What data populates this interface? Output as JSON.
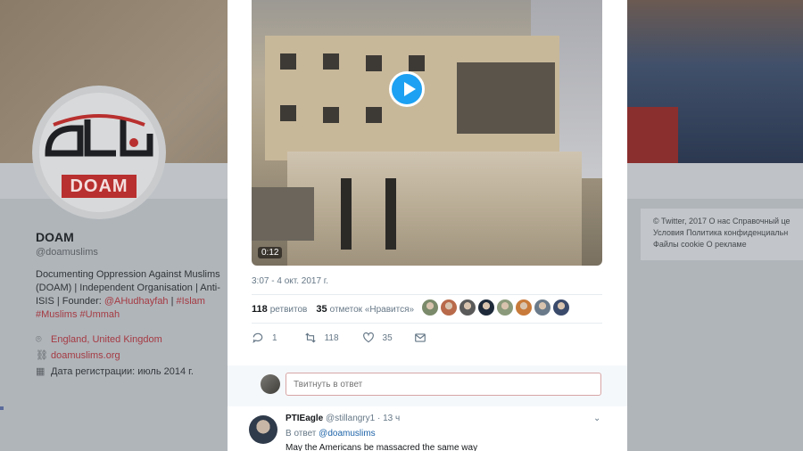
{
  "profile": {
    "logo_text": "DOAM",
    "name": "DOAM",
    "handle": "@doamuslims",
    "bio_text": "Documenting Oppression Against Muslims (DOAM) | Independent Organisation | Anti-ISIS | Founder: ",
    "bio_founder": "@AHudhayfah",
    "bio_sep": " | ",
    "bio_tag1": "#Islam",
    "bio_tag2": "#Muslims",
    "bio_tag3": "#Ummah",
    "location": "England, United Kingdom",
    "website": "doamuslims.org",
    "joined": "Дата регистрации: июль 2014 г."
  },
  "footer": {
    "line1": "© Twitter, 2017   О нас   Справочный це",
    "line2": "Условия   Политика конфиденциальн",
    "line3": "Файлы cookie   О рекламе"
  },
  "tweet": {
    "video_time": "0:12",
    "timestamp": "3:07 - 4 окт. 2017 г.",
    "retweets_count": "118",
    "retweets_label": "ретвитов",
    "likes_count": "35",
    "likes_label": "отметок «Нравится»",
    "liker_colors": [
      "#7a8a6a",
      "#b86a4a",
      "#5a5a5a",
      "#1e2a3a",
      "#8a9a7a",
      "#c87a3a",
      "#6a7a8a",
      "#3a4a6a"
    ],
    "reply_count": "1",
    "retweet_count": "118",
    "like_count": "35"
  },
  "reply_box": {
    "placeholder": "Твитнуть в ответ"
  },
  "reply": {
    "name": "PTIEagle",
    "handle": "@stillangry1",
    "time": "· 13 ч",
    "replying_label": "В ответ",
    "replying_to": "@doamuslims",
    "text": "May the Americans be massacred the same way"
  }
}
